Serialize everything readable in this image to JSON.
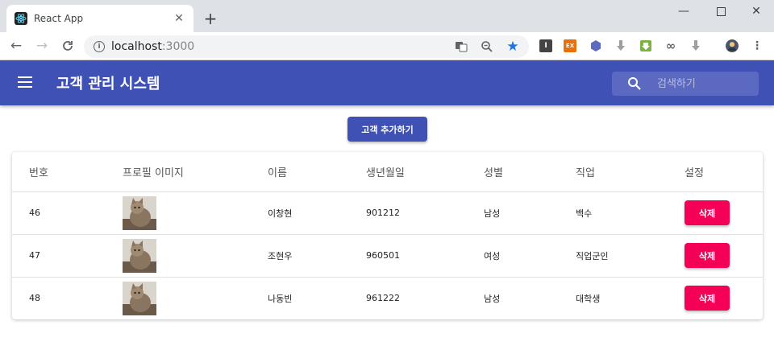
{
  "browser": {
    "tab_title": "React App",
    "new_tab_label": "+",
    "url_host": "localhost",
    "url_port": ":3000"
  },
  "appbar": {
    "title": "고객 관리 시스템",
    "search_placeholder": "검색하기"
  },
  "actions": {
    "add_customer_label": "고객 추가하기"
  },
  "table": {
    "headers": [
      "번호",
      "프로필 이미지",
      "이름",
      "생년월일",
      "성별",
      "직업",
      "설정"
    ],
    "rows": [
      {
        "id": "46",
        "image": "cat-photo",
        "name": "이창현",
        "birthday": "901212",
        "gender": "남성",
        "job": "백수",
        "action": "삭제"
      },
      {
        "id": "47",
        "image": "cat-photo",
        "name": "조현우",
        "birthday": "960501",
        "gender": "여성",
        "job": "직업군인",
        "action": "삭제"
      },
      {
        "id": "48",
        "image": "cat-photo",
        "name": "나동빈",
        "birthday": "961222",
        "gender": "남성",
        "job": "대학생",
        "action": "삭제"
      }
    ]
  },
  "colors": {
    "primary": "#3f51b5",
    "secondary": "#f50057"
  }
}
